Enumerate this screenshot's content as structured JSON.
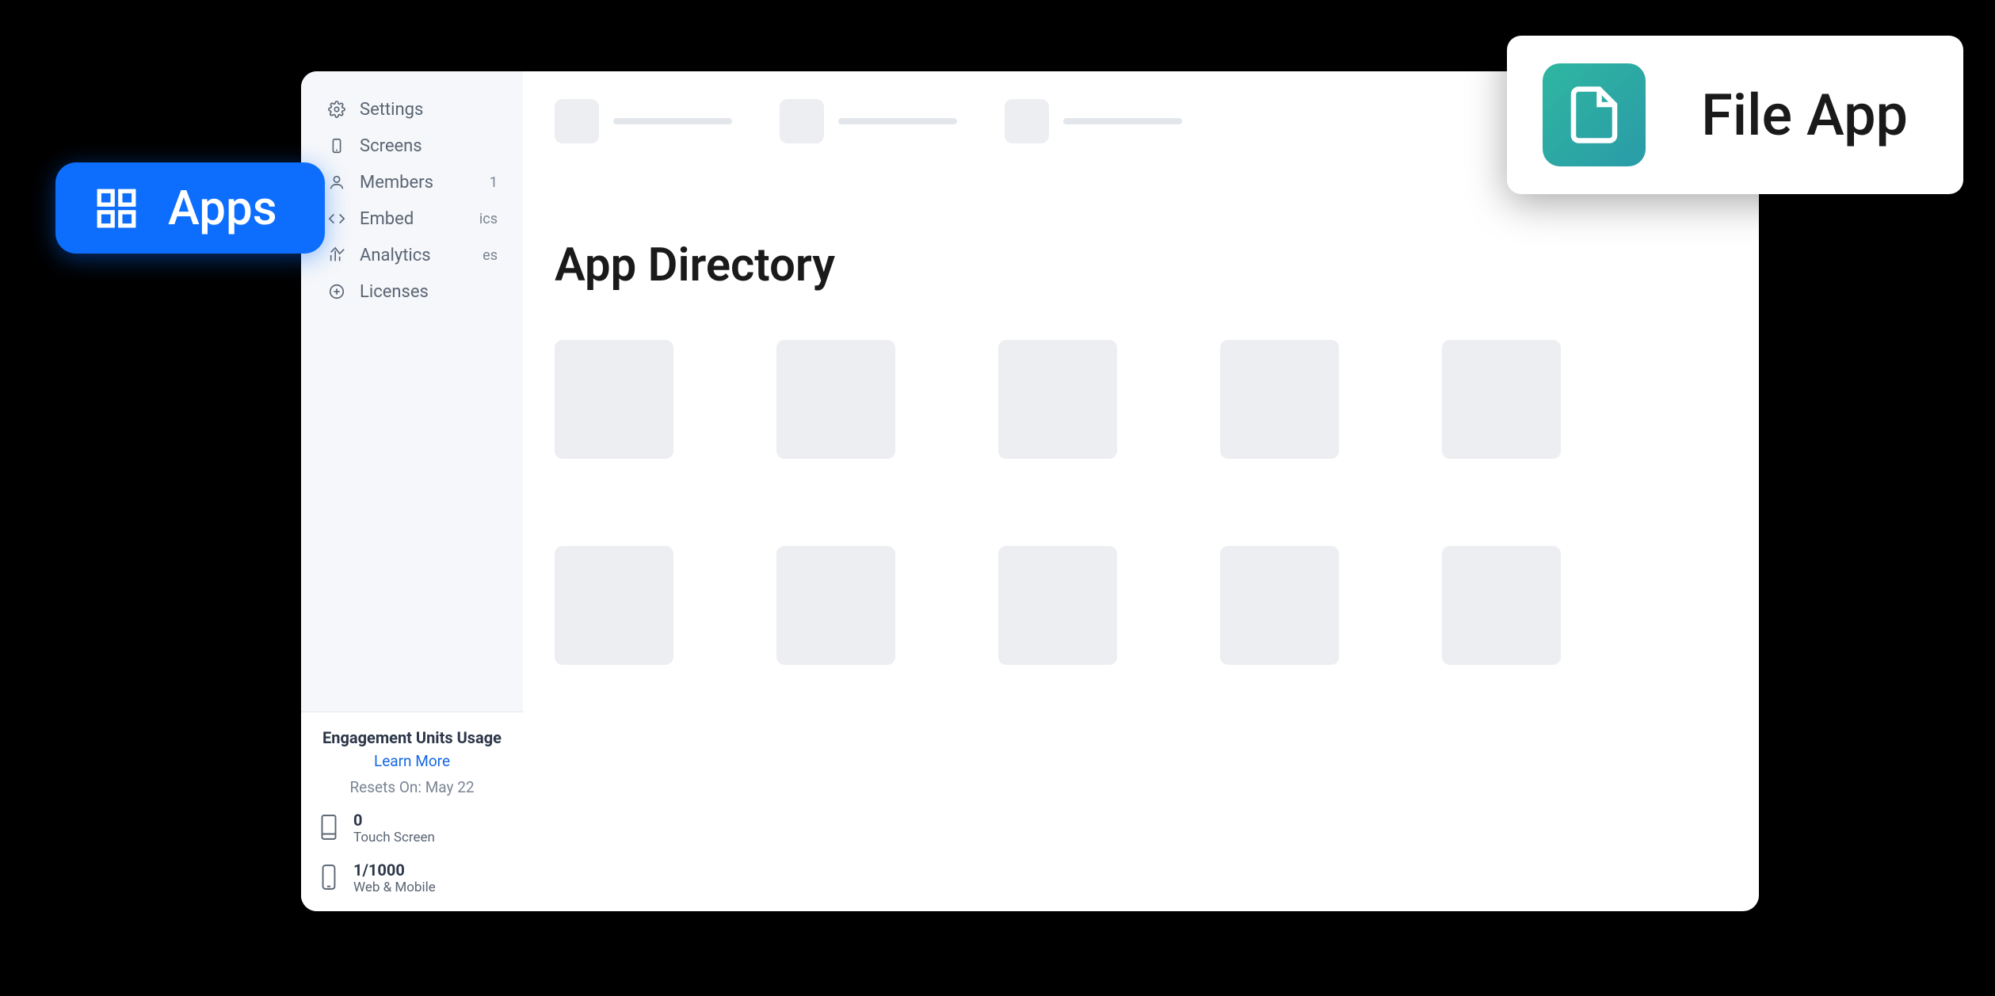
{
  "sidebar": {
    "items": [
      {
        "icon": "gear",
        "label": "Settings"
      },
      {
        "icon": "screen",
        "label": "Screens"
      },
      {
        "icon": "user",
        "label": "Members",
        "extra": "1"
      },
      {
        "icon": "code",
        "label": "Embed",
        "extra": "ics"
      },
      {
        "icon": "chart",
        "label": "Analytics",
        "extra": "es"
      },
      {
        "icon": "plus-circle",
        "label": "Licenses"
      }
    ]
  },
  "usage": {
    "title": "Engagement Units Usage",
    "learn": "Learn More",
    "reset": "Resets On: May 22",
    "rows": [
      {
        "count": "0",
        "label": "Touch Screen"
      },
      {
        "count": "1/1000",
        "label": "Web & Mobile"
      }
    ]
  },
  "main": {
    "title": "App Directory"
  },
  "apps_pill": {
    "label": "Apps"
  },
  "file_app": {
    "label": "File App"
  }
}
